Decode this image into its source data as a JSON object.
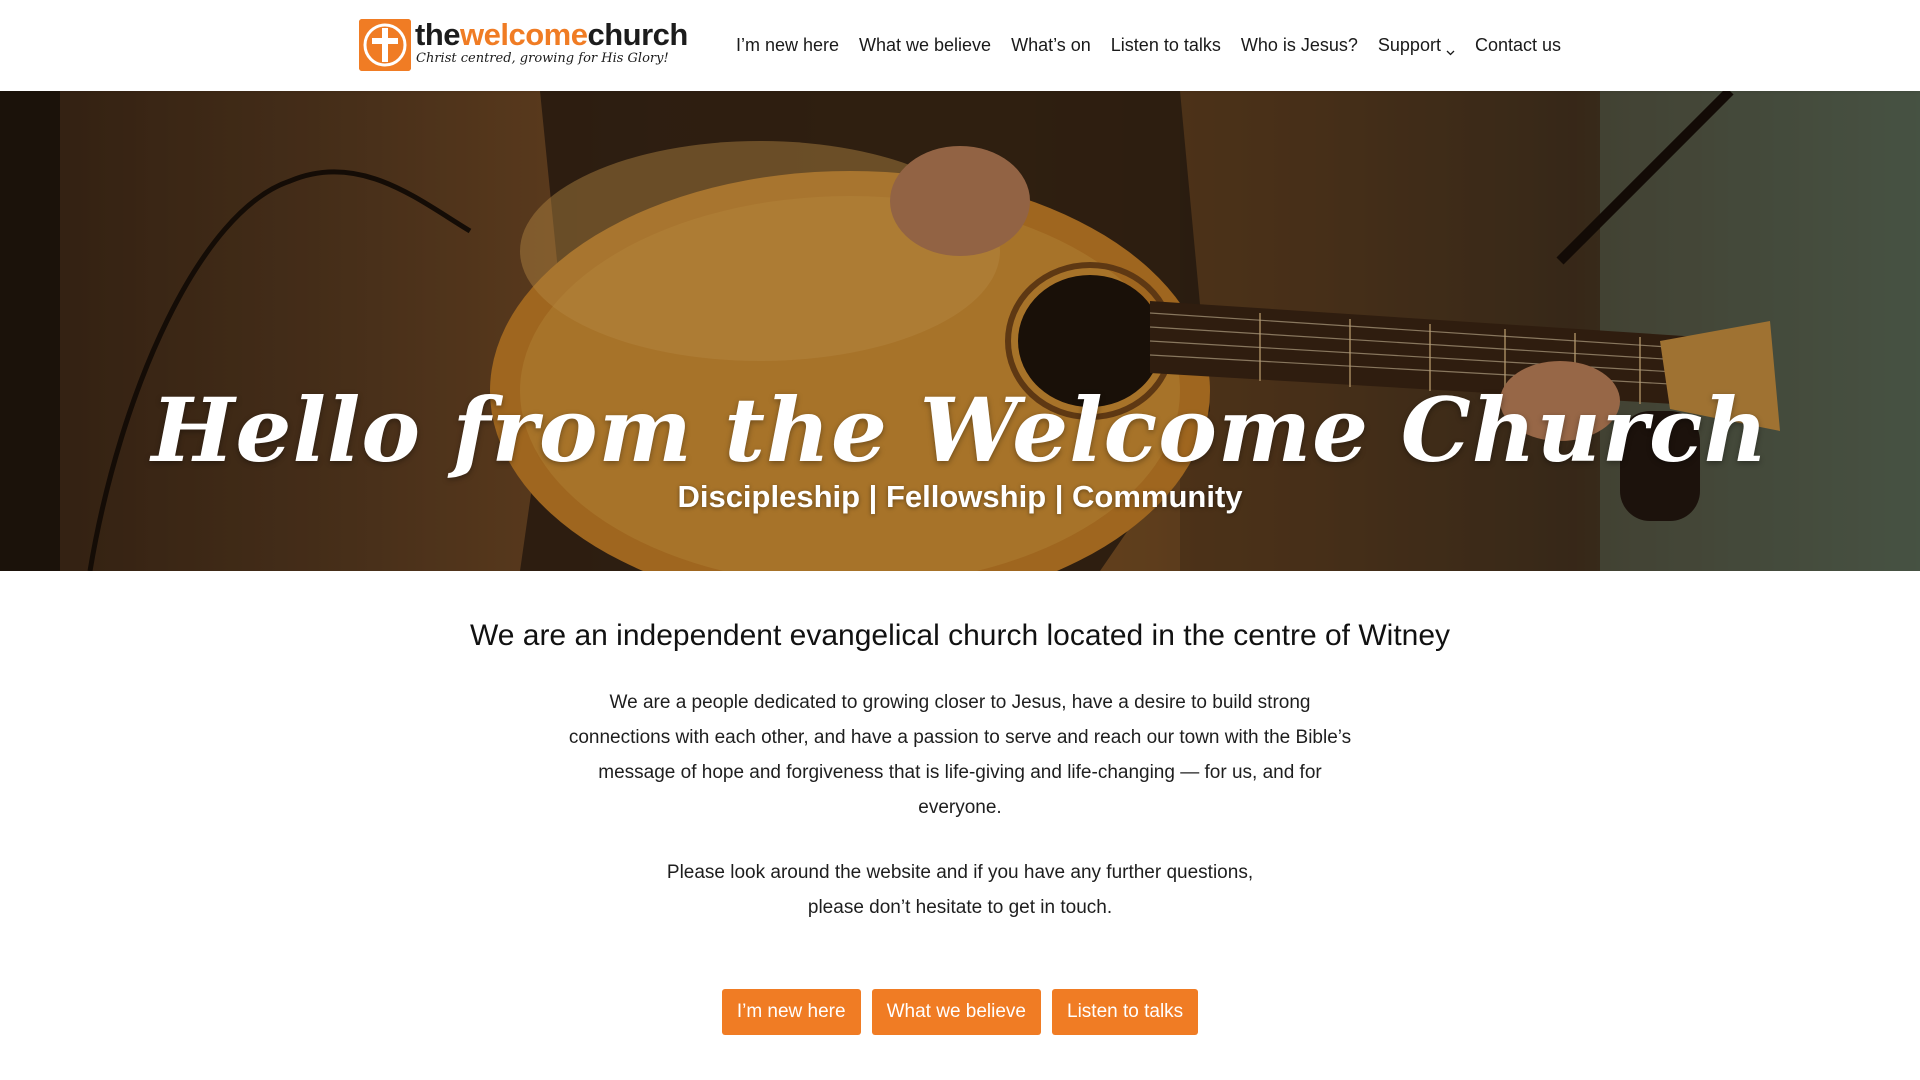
{
  "brand": {
    "name_part1": "the",
    "name_part2": "welcome",
    "name_part3": "church",
    "tagline": "Christ centred, growing for His Glory!",
    "accent_color": "#f07c24"
  },
  "nav": {
    "items": [
      {
        "label": "I’m new here"
      },
      {
        "label": "What we believe"
      },
      {
        "label": "What’s on"
      },
      {
        "label": "Listen to talks"
      },
      {
        "label": "Who is Jesus?"
      },
      {
        "label": "Support",
        "has_dropdown": true,
        "icon": "chevron-down-icon"
      },
      {
        "label": "Contact us"
      }
    ]
  },
  "hero": {
    "title": "Hello from the Welcome Church",
    "subtitle": "Discipleship | Fellowship | Community"
  },
  "intro": {
    "heading": "We are an independent evangelical church located in the centre of Witney",
    "body": "We are a people dedicated to growing closer to Jesus, have a desire to build strong connections with each other, and have a passion to serve and reach our town with the Bible’s message of hope and forgiveness that is life-giving and life-changing — for us, and for everyone.",
    "follow_up_line1": "Please look around the website and if you have any further questions,",
    "follow_up_line2": "please don’t hesitate to get in touch."
  },
  "cta_buttons": [
    {
      "label": "I’m new here"
    },
    {
      "label": "What we believe"
    },
    {
      "label": "Listen to talks"
    }
  ]
}
